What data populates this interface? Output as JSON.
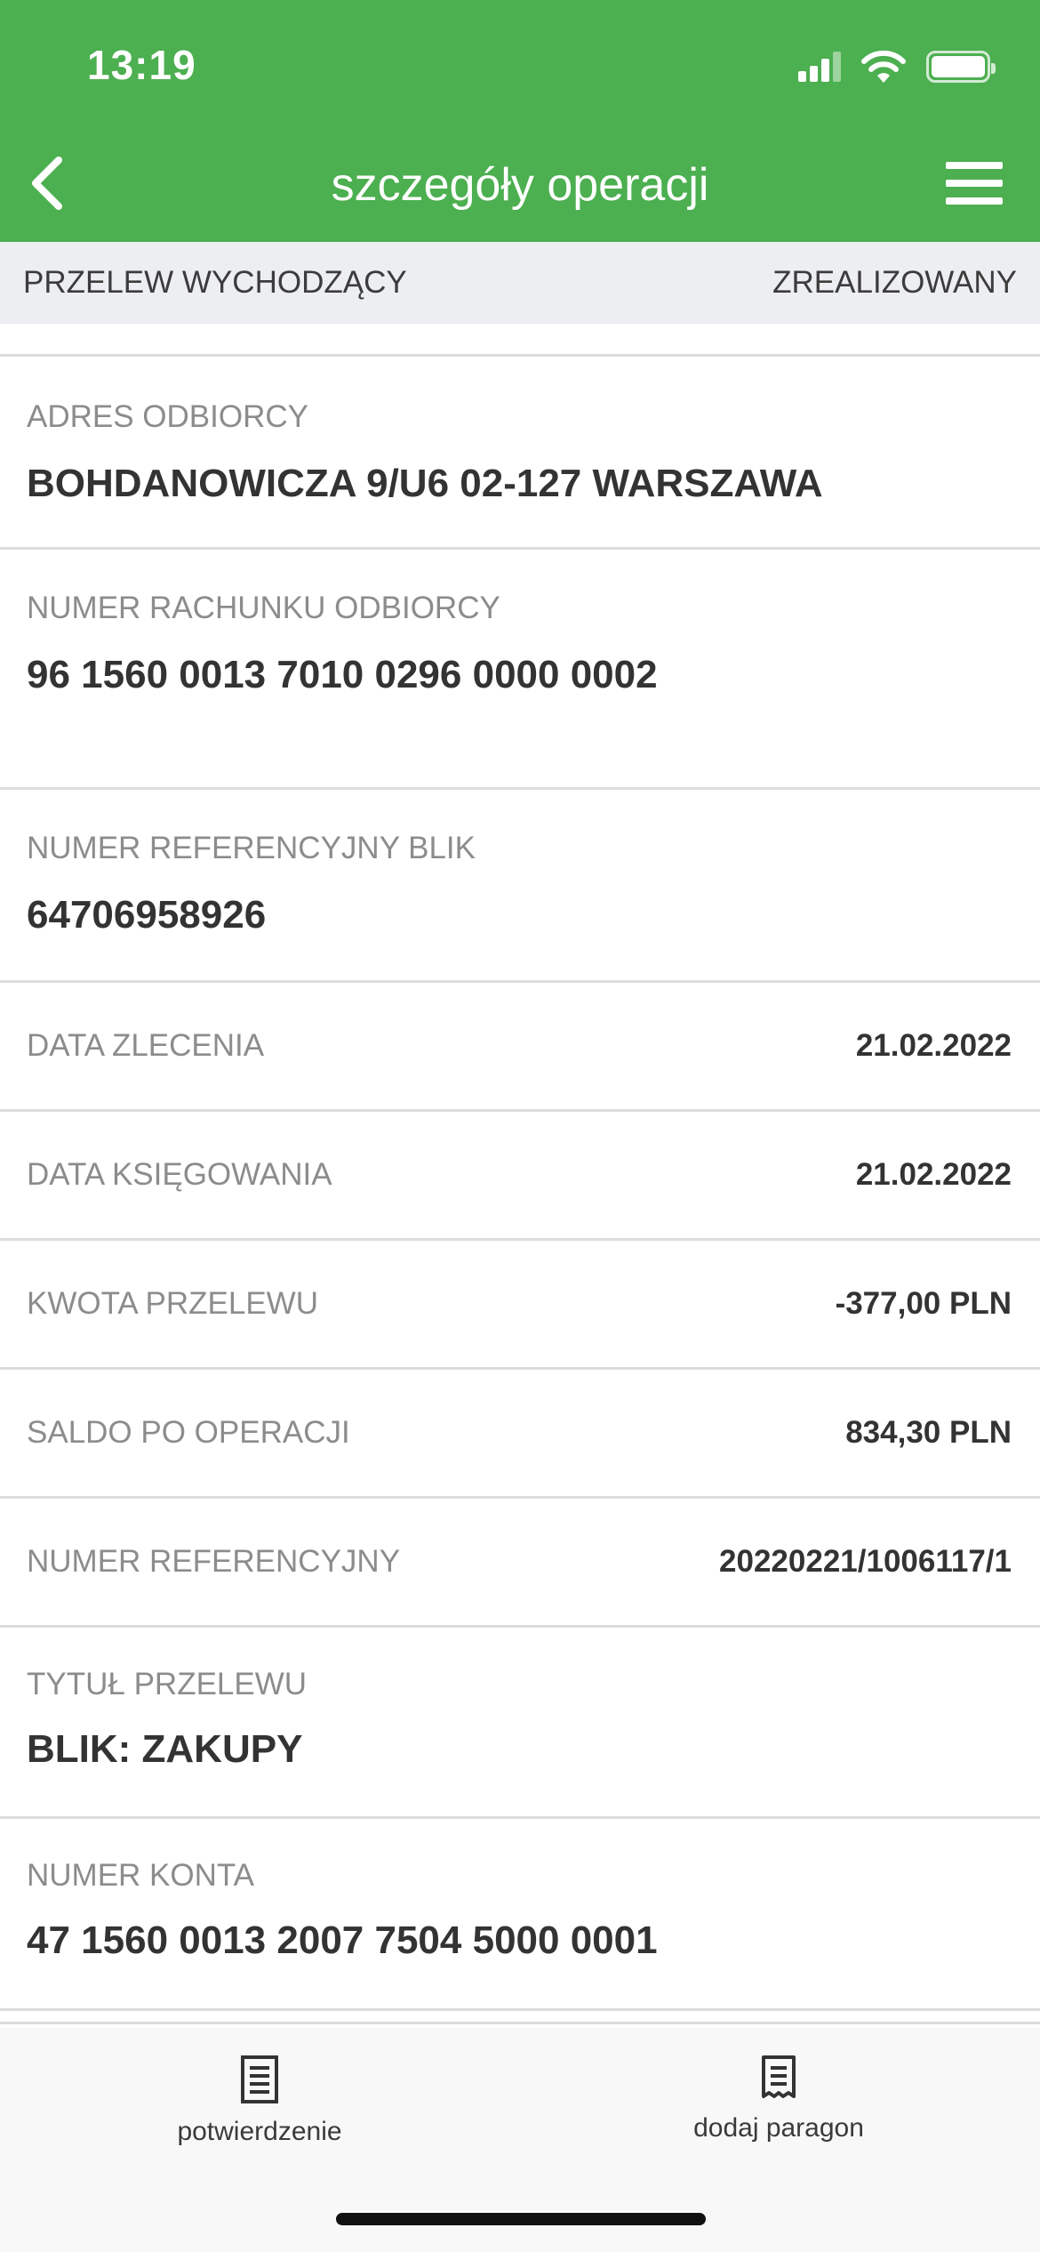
{
  "status_bar": {
    "time": "13:19"
  },
  "header": {
    "title": "szczegóły operacji",
    "back_icon": "chevron-left-icon",
    "menu_icon": "hamburger-menu-icon",
    "background": "#4caf50"
  },
  "subheader": {
    "type": "PRZELEW WYCHODZĄCY",
    "status": "ZREALIZOWANY"
  },
  "details": {
    "recipient_address": {
      "label": "ADRES ODBIORCY",
      "value": "BOHDANOWICZA 9/U6 02-127 WARSZAWA"
    },
    "recipient_account": {
      "label": "NUMER RACHUNKU ODBIORCY",
      "value": "96 1560 0013 7010 0296 0000 0002"
    },
    "blik_reference": {
      "label": "NUMER REFERENCYJNY BLIK",
      "value": "64706958926"
    },
    "order_date": {
      "label": "DATA ZLECENIA",
      "value": "21.02.2022"
    },
    "posting_date": {
      "label": "DATA KSIĘGOWANIA",
      "value": "21.02.2022"
    },
    "amount": {
      "label": "KWOTA PRZELEWU",
      "value": "-377,00 PLN"
    },
    "balance_after": {
      "label": "SALDO PO OPERACJI",
      "value": "834,30 PLN"
    },
    "reference": {
      "label": "NUMER REFERENCYJNY",
      "value": "20220221/1006117/1"
    },
    "title": {
      "label": "TYTUŁ PRZELEWU",
      "value": "BLIK: ZAKUPY"
    },
    "account": {
      "label": "NUMER KONTA",
      "value": "47 1560 0013 2007 7504 5000 0001"
    }
  },
  "bottom_bar": {
    "confirmation": {
      "label": "potwierdzenie",
      "icon": "document-icon"
    },
    "add_receipt": {
      "label": "dodaj paragon",
      "icon": "receipt-icon"
    }
  }
}
